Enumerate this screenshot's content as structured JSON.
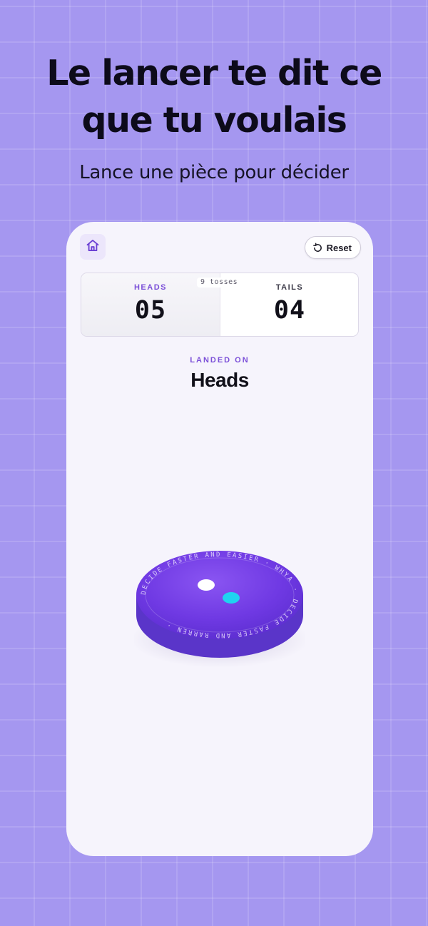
{
  "promo": {
    "headline_line1": "Le lancer te dit ce",
    "headline_line2": "que tu voulais",
    "subline": "Lance une pièce pour décider"
  },
  "app": {
    "home_icon": "home-icon",
    "reset_icon": "reset-icon",
    "reset_label": "Reset",
    "score": {
      "heads_label": "HEADS",
      "heads_value": "05",
      "tails_label": "TAILS",
      "tails_value": "04",
      "tosses": "9 tosses"
    },
    "result": {
      "label": "LANDED ON",
      "value": "Heads"
    },
    "coin": {
      "rim_text": "DECIDE FASTER AND EASIER · WHYA · DECIDE FASTER AND RARREN ·"
    }
  },
  "colors": {
    "background": "#a597f0",
    "accent": "#7b4fd8",
    "coin_face": "#6f39e3",
    "coin_edge": "#5a35c9",
    "coin_dot_white": "#ffffff",
    "coin_dot_cyan": "#1fd3f0"
  }
}
